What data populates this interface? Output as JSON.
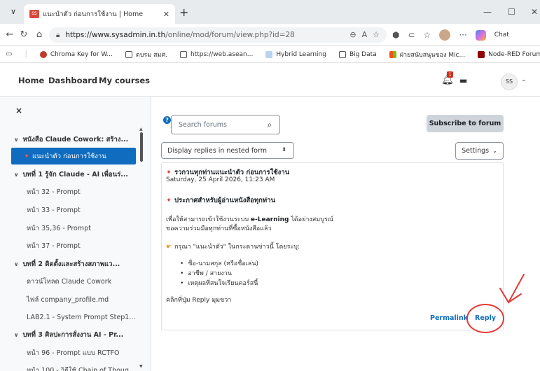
{
  "browser": {
    "tab_title": "แนะนำตัว ก่อนการใช้งาน | Home",
    "new_tab_icon": "plus-icon",
    "url_host": "https://www.sysadmin.in.th",
    "url_path": "/online/mod/forum/view.php?id=28",
    "bookmarks": [
      "Chroma Key for W...",
      "ตบรม สมศ.",
      "https://web.asean...",
      "Hybrid Learning",
      "Big Data",
      "ฝ่ายสนับสนุนของ Mic...",
      "Node-RED Forum"
    ],
    "sidebar_right_label": "Chat"
  },
  "topnav": {
    "home": "Home",
    "dashboard": "Dashboard",
    "my_courses": "My courses",
    "notification_count": "1",
    "user_initials": "SS"
  },
  "drawer": {
    "close": "×",
    "items": [
      "หนังสือ Claude Cowork: สร้าง...",
      "แนะนำตัว ก่อนการใช้งาน",
      "บทที่ 1 รู้จัก Claude - AI เพื่อนร่...",
      "หน้า 32 - Prompt",
      "หน้า 33 - Prompt",
      "หน้า 35,36 - Prompt",
      "หน้า 37 - Prompt",
      "บทที่ 2 ติดตั้งและสร้างสภาพแว...",
      "ดาวน์โหลด Claude Cowork",
      "ไฟล์ company_profile.md",
      "LAB2.1 - System Prompt Step1...",
      "บทที่ 3 ศิลปะการสั่งงาน AI - Pr...",
      "หน้า 96 - Prompt แบบ RCTFO",
      "หน้า 100 - วิธีใช้ Chain of Thoug..."
    ]
  },
  "forum": {
    "search_placeholder": "Search forums",
    "subscribe": "Subscribe to forum",
    "display_mode": "Display replies in nested form",
    "settings": "Settings",
    "post": {
      "subject": "รวกวนทุกท่านแนะนำตัว ก่อนการใช้งาน",
      "date": "Saturday, 25 April 2026, 11:23 AM",
      "heading": "ประกาศสำหรับผู้อ่านหนังสือทุกท่าน",
      "line1_pre": "เพื่อให้สามารถเข้าใช้งานระบบ ",
      "line1_bold": "e-Learning",
      "line1_post": " ได้อย่างสมบูรณ์",
      "line2": "ขอความร่วมมือทุกท่านที่ซื้อหนังสือแล้ว",
      "instruction": "กรุณา \"แนะนำตัว\" ในกระดานข่าวนี้ โดยระบุ:",
      "bullets": [
        "ชื่อ-นามสกุล (หรือชื่อเล่น)",
        "อาชีพ / สายงาน",
        "เหตุผลที่สนใจเรียนคอร์สนี้"
      ],
      "footer_note": "คลิกที่ปุ่ม Reply มุมขวา",
      "permalink": "Permalink",
      "reply": "Reply"
    }
  }
}
